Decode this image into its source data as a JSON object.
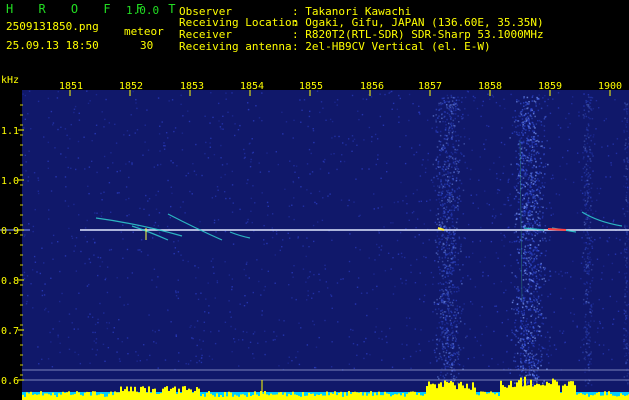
{
  "header": {
    "app_title": "H R O F F T",
    "version": "1.0.0",
    "filename": "2509131850.png",
    "meteor_label": "meteor",
    "datetime": "25.09.13 18:50",
    "meteor_count": "30",
    "info": [
      {
        "key": "Observer",
        "value": ": Takanori Kawachi"
      },
      {
        "key": "Receiving Location",
        "value": ": Ogaki, Gifu, JAPAN (136.60E, 35.35N)"
      },
      {
        "key": "Receiver",
        "value": ": R820T2(RTL-SDR) SDR-Sharp 53.1000MHz"
      },
      {
        "key": "Receiving antenna",
        "value": ": 2el-HB9CV Vertical (el. E-W)"
      }
    ]
  },
  "plot": {
    "y_unit": "kHz",
    "x_ticks": [
      "1851",
      "1852",
      "1853",
      "1854",
      "1855",
      "1856",
      "1857",
      "1858",
      "1859",
      "1900"
    ],
    "y_ticks": [
      "1.1",
      "1.0",
      "0.9",
      "0.8",
      "0.7",
      "0.6"
    ],
    "colors": {
      "background": "#10186a",
      "noise": "#2a3cc0",
      "carrier": "#e0e8ff",
      "meteor": "#30d0d0",
      "text_yellow": "#ffff00",
      "text_green": "#22dd22",
      "level_bar": "#ffff00",
      "level_base": "#00ccff"
    }
  }
}
